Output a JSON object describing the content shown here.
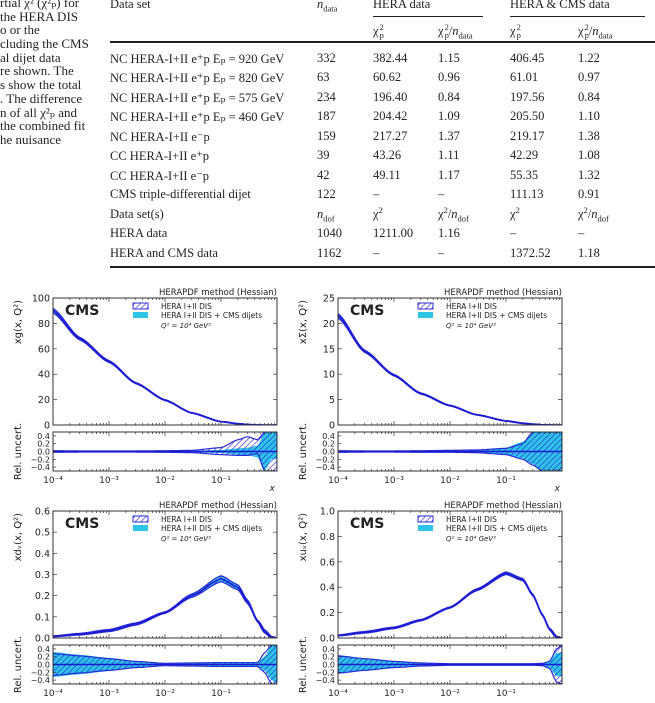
{
  "side_text": [
    "rtial χ² (χ²ₚ) for",
    "the HERA DIS",
    "o or the",
    "cluding the CMS",
    "al dijet data",
    "re shown. The",
    "s show the total",
    ". The difference",
    "n of all χ²ₚ and",
    "the combined fit",
    "he nuisance"
  ],
  "table": {
    "headers": {
      "data_set": "Data set",
      "n": "n",
      "data_sub": "data",
      "hera_data": "HERA data",
      "hera_cms_data": "HERA & CMS data",
      "chi": "χ",
      "sq": "2",
      "p": "p",
      "slash": "/",
      "data_sets": "Data set(s)",
      "dof_sub": "dof"
    },
    "rows": [
      {
        "label": "NC HERA-I+II e⁺p Eₚ = 920 GeV",
        "n": "332",
        "hera_chi2": "382.44",
        "hera_ratio": "1.15",
        "cms_chi2": "406.45",
        "cms_ratio": "1.22"
      },
      {
        "label": "NC HERA-I+II e⁺p Eₚ = 820 GeV",
        "n": "63",
        "hera_chi2": "60.62",
        "hera_ratio": "0.96",
        "cms_chi2": "61.01",
        "cms_ratio": "0.97"
      },
      {
        "label": "NC HERA-I+II e⁺p Eₚ = 575 GeV",
        "n": "234",
        "hera_chi2": "196.40",
        "hera_ratio": "0.84",
        "cms_chi2": "197.56",
        "cms_ratio": "0.84"
      },
      {
        "label": "NC HERA-I+II e⁺p Eₚ = 460 GeV",
        "n": "187",
        "hera_chi2": "204.42",
        "hera_ratio": "1.09",
        "cms_chi2": "205.50",
        "cms_ratio": "1.10"
      },
      {
        "label": "NC HERA-I+II e⁻p",
        "n": "159",
        "hera_chi2": "217.27",
        "hera_ratio": "1.37",
        "cms_chi2": "219.17",
        "cms_ratio": "1.38"
      },
      {
        "label": "CC HERA-I+II e⁺p",
        "n": "39",
        "hera_chi2": "43.26",
        "hera_ratio": "1.11",
        "cms_chi2": "42.29",
        "cms_ratio": "1.08"
      },
      {
        "label": "CC HERA-I+II e⁻p",
        "n": "42",
        "hera_chi2": "49.11",
        "hera_ratio": "1.17",
        "cms_chi2": "55.35",
        "cms_ratio": "1.32"
      },
      {
        "label": "CMS triple-differential dijet",
        "n": "122",
        "hera_chi2": "–",
        "hera_ratio": "–",
        "cms_chi2": "111.13",
        "cms_ratio": "0.91"
      }
    ],
    "totals": [
      {
        "label": "HERA data",
        "n": "1040",
        "hera_chi2": "1211.00",
        "hera_ratio": "1.16",
        "cms_chi2": "–",
        "cms_ratio": "–"
      },
      {
        "label": "HERA and CMS data",
        "n": "1162",
        "hera_chi2": "–",
        "hera_ratio": "–",
        "cms_chi2": "1372.52",
        "cms_ratio": "1.18"
      }
    ]
  },
  "chart_data": [
    {
      "type": "area",
      "title": "HERAPDF method (Hessian)",
      "logo": "CMS",
      "ylabel": "xg(x, Q²)",
      "ratio_ylabel": "Rel. uncert.",
      "xlabel": "x",
      "legend": [
        "HERA I+II DIS",
        "HERA I+II DIS + CMS dijets"
      ],
      "annotation": "Q² = 10⁴ GeV²",
      "xscale": "log",
      "xlim": [
        0.0001,
        1
      ],
      "xticks": [
        "10⁻⁴",
        "10⁻³",
        "10⁻²",
        "10⁻¹"
      ],
      "ylim": [
        0,
        100
      ],
      "yticks": [
        "0",
        "20",
        "40",
        "60",
        "80",
        "100"
      ],
      "ratio_ylim": [
        -0.5,
        0.5
      ],
      "ratio_yticks": [
        "−0.4",
        "−0.2",
        "0.0",
        "0.2",
        "0.4"
      ],
      "x": [
        0.0001,
        0.0003,
        0.001,
        0.003,
        0.01,
        0.03,
        0.1,
        0.2,
        0.3,
        0.45,
        0.6,
        0.8,
        1
      ],
      "central": [
        90,
        68,
        50,
        33,
        19.6,
        9.5,
        2.6,
        1.0,
        0.4,
        0.1,
        0.03,
        0.005,
        0
      ],
      "hera_rel_up": [
        0.02,
        0.015,
        0.015,
        0.015,
        0.02,
        0.03,
        0.1,
        0.3,
        0.38,
        0.3,
        0.5,
        0.5,
        0.5
      ],
      "hera_rel_down": [
        -0.02,
        -0.015,
        -0.015,
        -0.015,
        -0.02,
        -0.03,
        -0.08,
        -0.1,
        -0.1,
        -0.05,
        -0.5,
        -0.5,
        -0.5
      ],
      "cms_rel_up": [
        0.015,
        0.01,
        0.01,
        0.01,
        0.015,
        0.02,
        0.04,
        0.08,
        0.1,
        0.15,
        0.5,
        0.5,
        0.5
      ],
      "cms_rel_down": [
        -0.015,
        -0.01,
        -0.01,
        -0.01,
        -0.015,
        -0.02,
        -0.04,
        -0.08,
        -0.1,
        -0.15,
        -0.5,
        -0.2,
        -0.2
      ],
      "colors": {
        "hera": "#2b2bd8",
        "cms": "#2ec4e6",
        "central": "#1a1ad0"
      }
    },
    {
      "type": "area",
      "title": "HERAPDF method (Hessian)",
      "logo": "CMS",
      "ylabel": "xΣ(x, Q²)",
      "ratio_ylabel": "Rel. uncert.",
      "xlabel": "x",
      "legend": [
        "HERA I+II DIS",
        "HERA I+II DIS + CMS dijets"
      ],
      "annotation": "Q² = 10⁴ GeV²",
      "xscale": "log",
      "xlim": [
        0.0001,
        1
      ],
      "xticks": [
        "10⁻⁴",
        "10⁻³",
        "10⁻²",
        "10⁻¹"
      ],
      "ylim": [
        0,
        25
      ],
      "yticks": [
        "0",
        "5",
        "10",
        "15",
        "20",
        "25"
      ],
      "ratio_ylim": [
        -0.5,
        0.5
      ],
      "ratio_yticks": [
        "−0.4",
        "−0.2",
        "0.0",
        "0.2",
        "0.4"
      ],
      "x": [
        0.0001,
        0.0003,
        0.001,
        0.003,
        0.01,
        0.03,
        0.1,
        0.2,
        0.3,
        0.45,
        0.6,
        0.8,
        1
      ],
      "central": [
        21.5,
        14.5,
        9.8,
        6.2,
        3.8,
        2.0,
        0.8,
        0.35,
        0.15,
        0.05,
        0.02,
        0.005,
        0
      ],
      "hera_rel_up": [
        0.02,
        0.015,
        0.015,
        0.02,
        0.03,
        0.04,
        0.08,
        0.2,
        0.5,
        0.5,
        0.5,
        0.5,
        0.5
      ],
      "hera_rel_down": [
        -0.02,
        -0.015,
        -0.015,
        -0.02,
        -0.02,
        -0.03,
        -0.08,
        -0.2,
        -0.35,
        -0.5,
        -0.5,
        -0.5,
        -0.5
      ],
      "cms_rel_up": [
        0.02,
        0.015,
        0.015,
        0.02,
        0.03,
        0.04,
        0.1,
        0.25,
        0.5,
        0.5,
        0.5,
        0.5,
        0.5
      ],
      "cms_rel_down": [
        -0.02,
        -0.015,
        -0.015,
        -0.02,
        -0.02,
        -0.03,
        -0.07,
        -0.18,
        -0.32,
        -0.5,
        -0.5,
        -0.5,
        -0.5
      ],
      "colors": {
        "hera": "#2b2bd8",
        "cms": "#2ec4e6",
        "central": "#1a1ad0"
      }
    },
    {
      "type": "area",
      "title": "HERAPDF method (Hessian)",
      "logo": "CMS",
      "ylabel": "xdᵥ(x, Q²)",
      "ratio_ylabel": "Rel. uncert.",
      "xlabel": "",
      "legend": [
        "HERA I+II DIS",
        "HERA I+II DIS + CMS dijets"
      ],
      "annotation": "Q² = 10⁴ GeV²",
      "xscale": "log",
      "xlim": [
        0.0001,
        1
      ],
      "xticks": [
        "10⁻⁴",
        "10⁻³",
        "10⁻²",
        "10⁻¹"
      ],
      "ylim": [
        0,
        0.6
      ],
      "yticks": [
        "0.0",
        "0.1",
        "0.2",
        "0.3",
        "0.4",
        "0.5",
        "0.6"
      ],
      "ratio_ylim": [
        -0.5,
        0.5
      ],
      "ratio_yticks": [
        "−0.4",
        "−0.2",
        "0.0",
        "0.2",
        "0.4"
      ],
      "x": [
        0.0001,
        0.0003,
        0.001,
        0.003,
        0.01,
        0.03,
        0.1,
        0.2,
        0.3,
        0.45,
        0.6,
        0.8,
        1
      ],
      "central": [
        0.008,
        0.018,
        0.035,
        0.066,
        0.12,
        0.2,
        0.28,
        0.24,
        0.17,
        0.08,
        0.03,
        0.005,
        0
      ],
      "hera_rel_up": [
        0.28,
        0.22,
        0.15,
        0.08,
        0.03,
        0.04,
        0.05,
        0.05,
        0.05,
        0.05,
        0.3,
        0.5,
        0.5
      ],
      "hera_rel_down": [
        -0.28,
        -0.22,
        -0.15,
        -0.08,
        -0.03,
        -0.04,
        -0.05,
        -0.05,
        -0.05,
        -0.05,
        -0.2,
        -0.5,
        -0.5
      ],
      "cms_rel_up": [
        0.32,
        0.25,
        0.17,
        0.09,
        0.035,
        0.04,
        0.06,
        0.06,
        0.06,
        0.06,
        0.2,
        0.5,
        0.5
      ],
      "cms_rel_down": [
        -0.32,
        -0.25,
        -0.17,
        -0.09,
        -0.035,
        -0.04,
        -0.06,
        -0.06,
        -0.06,
        -0.06,
        -0.15,
        -0.4,
        -0.5
      ],
      "colors": {
        "hera": "#2b2bd8",
        "cms": "#2ec4e6",
        "central": "#1a1ad0"
      }
    },
    {
      "type": "area",
      "title": "HERAPDF method (Hessian)",
      "logo": "CMS",
      "ylabel": "xuᵥ(x, Q²)",
      "ratio_ylabel": "Rel. uncert.",
      "xlabel": "",
      "legend": [
        "HERA I+II DIS",
        "HERA I+II DIS + CMS dijets"
      ],
      "annotation": "Q² = 10⁴ GeV²",
      "xscale": "log",
      "xlim": [
        0.0001,
        1
      ],
      "xticks": [
        "10⁻⁴",
        "10⁻³",
        "10⁻²",
        "10⁻¹"
      ],
      "ylim": [
        0,
        1.0
      ],
      "yticks": [
        "0.0",
        "0.2",
        "0.4",
        "0.6",
        "0.8",
        "1.0"
      ],
      "ratio_ylim": [
        -0.5,
        0.5
      ],
      "ratio_yticks": [
        "−0.4",
        "−0.2",
        "0.0",
        "0.2",
        "0.4"
      ],
      "x": [
        0.0001,
        0.0003,
        0.001,
        0.003,
        0.01,
        0.03,
        0.1,
        0.2,
        0.3,
        0.45,
        0.6,
        0.8,
        1
      ],
      "central": [
        0.02,
        0.045,
        0.08,
        0.14,
        0.24,
        0.38,
        0.51,
        0.46,
        0.34,
        0.18,
        0.07,
        0.01,
        0
      ],
      "hera_rel_up": [
        0.22,
        0.15,
        0.08,
        0.04,
        0.02,
        0.02,
        0.02,
        0.02,
        0.02,
        0.03,
        0.08,
        0.4,
        0.5
      ],
      "hera_rel_down": [
        -0.22,
        -0.15,
        -0.08,
        -0.04,
        -0.02,
        -0.02,
        -0.02,
        -0.02,
        -0.02,
        -0.03,
        -0.1,
        -0.45,
        -0.5
      ],
      "cms_rel_up": [
        0.24,
        0.16,
        0.09,
        0.045,
        0.025,
        0.02,
        0.02,
        0.02,
        0.02,
        0.03,
        0.08,
        0.3,
        0.3
      ],
      "cms_rel_down": [
        -0.24,
        -0.16,
        -0.09,
        -0.045,
        -0.025,
        -0.02,
        -0.02,
        -0.02,
        -0.02,
        -0.03,
        -0.08,
        -0.3,
        -0.3
      ],
      "colors": {
        "hera": "#2b2bd8",
        "cms": "#2ec4e6",
        "central": "#1a1ad0"
      }
    }
  ]
}
